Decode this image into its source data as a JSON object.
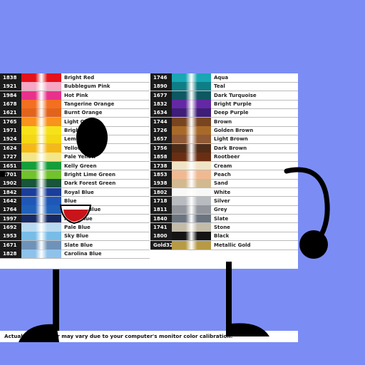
{
  "background": "#7b8df5",
  "chart": {
    "left_column": [
      {
        "code": "1838",
        "name": "Bright Red",
        "color": "#e3121b"
      },
      {
        "code": "1921",
        "name": "Bubblegum Pink",
        "color": "#f7a6c4"
      },
      {
        "code": "1984",
        "name": "Hot Pink",
        "color": "#e8318b"
      },
      {
        "code": "1678",
        "name": "Tangerine Orange",
        "color": "#f36f21"
      },
      {
        "code": "1621",
        "name": "Burnt Orange",
        "color": "#e2641b"
      },
      {
        "code": "1765",
        "name": "Light Orange",
        "color": "#f7931e"
      },
      {
        "code": "1971",
        "name": "Bright Yellow",
        "color": "#f6e21a"
      },
      {
        "code": "1924",
        "name": "Lemon Yellow",
        "color": "#f4d715"
      },
      {
        "code": "1624",
        "name": "Yellow Gold",
        "color": "#f5b917"
      },
      {
        "code": "1727",
        "name": "Pale Yellow",
        "color": "#f3e68a"
      },
      {
        "code": "1651",
        "name": "Kelly Green",
        "color": "#159d3c"
      },
      {
        "code": "1701",
        "name": "Bright Lime Green",
        "color": "#71c32c"
      },
      {
        "code": "1902",
        "name": "Dark Forest Green",
        "color": "#18553a"
      },
      {
        "code": "1842",
        "name": "Royal Blue",
        "color": "#1b3e9c"
      },
      {
        "code": "1642",
        "name": "Blue",
        "color": "#1f57b8"
      },
      {
        "code": "1764",
        "name": "Medium Blue",
        "color": "#1f61b9"
      },
      {
        "code": "1997",
        "name": "Navy Blue",
        "color": "#152b66"
      },
      {
        "code": "1692",
        "name": "Pale Blue",
        "color": "#b9d9f0"
      },
      {
        "code": "1953",
        "name": "Sky Blue",
        "color": "#78bde8"
      },
      {
        "code": "1671",
        "name": "Slate Blue",
        "color": "#6f92b8"
      },
      {
        "code": "1828",
        "name": "Carolina Blue",
        "color": "#8ec2ea"
      }
    ],
    "right_column": [
      {
        "code": "1746",
        "name": "Aqua",
        "color": "#19a7b4"
      },
      {
        "code": "1890",
        "name": "Teal",
        "color": "#0d7e86"
      },
      {
        "code": "1677",
        "name": "Dark Turquoise",
        "color": "#0e5861"
      },
      {
        "code": "1832",
        "name": "Bright Purple",
        "color": "#6428a3"
      },
      {
        "code": "1634",
        "name": "Deep Purple",
        "color": "#3e1e76"
      },
      {
        "code": "1744",
        "name": "Brown",
        "color": "#774520"
      },
      {
        "code": "1726",
        "name": "Golden Brown",
        "color": "#a86a29"
      },
      {
        "code": "1657",
        "name": "Light Brown",
        "color": "#8f5a35"
      },
      {
        "code": "1756",
        "name": "Dark Brown",
        "color": "#4f2c17"
      },
      {
        "code": "1858",
        "name": "Rootbeer",
        "color": "#6a2e12"
      },
      {
        "code": "1738",
        "name": "Cream",
        "color": "#efe4c6"
      },
      {
        "code": "1853",
        "name": "Peach",
        "color": "#f0b992"
      },
      {
        "code": "1938",
        "name": "Sand",
        "color": "#d2b990"
      },
      {
        "code": "1802",
        "name": "White",
        "color": "#f8f8f6"
      },
      {
        "code": "1718",
        "name": "Silver",
        "color": "#b8bcc1"
      },
      {
        "code": "1811",
        "name": "Grey",
        "color": "#92969c"
      },
      {
        "code": "1840",
        "name": "Slate",
        "color": "#6a7480"
      },
      {
        "code": "1741",
        "name": "Stone",
        "color": "#c2bba8"
      },
      {
        "code": "1800",
        "name": "Black",
        "color": "#141414"
      },
      {
        "code": "Gold32",
        "name": "Metallic Gold",
        "color": "#b79a45"
      }
    ],
    "footer": "Actual thread color may vary due to your computer's monitor color calibration."
  }
}
